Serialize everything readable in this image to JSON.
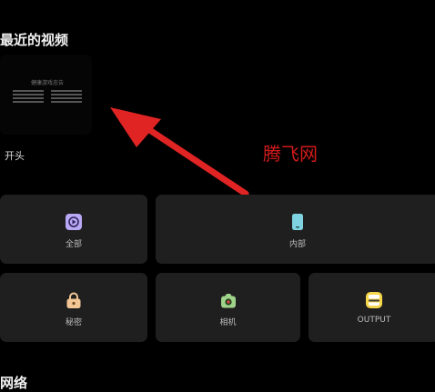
{
  "recent": {
    "title": "最近的视频",
    "video": {
      "thumbnail_title": "健康游戏忠告",
      "label": "开头"
    }
  },
  "watermark": "腾飞网",
  "folders": [
    {
      "label": "全部",
      "icon": "play-icon",
      "color": "#b9a8f5"
    },
    {
      "label": "内部",
      "icon": "phone-icon",
      "color": "#7fd3e0"
    },
    {
      "label": "秘密",
      "icon": "lock-icon",
      "color": "#f3c795"
    },
    {
      "label": "相机",
      "icon": "camera-icon",
      "color": "#9fd38a"
    },
    {
      "label": "OUTPUT",
      "icon": "folder-icon",
      "color": "#f5d54a"
    }
  ],
  "network": {
    "title": "网络"
  },
  "colors": {
    "background": "#000000",
    "card": "#1f1f1f",
    "arrow": "#e02424"
  }
}
